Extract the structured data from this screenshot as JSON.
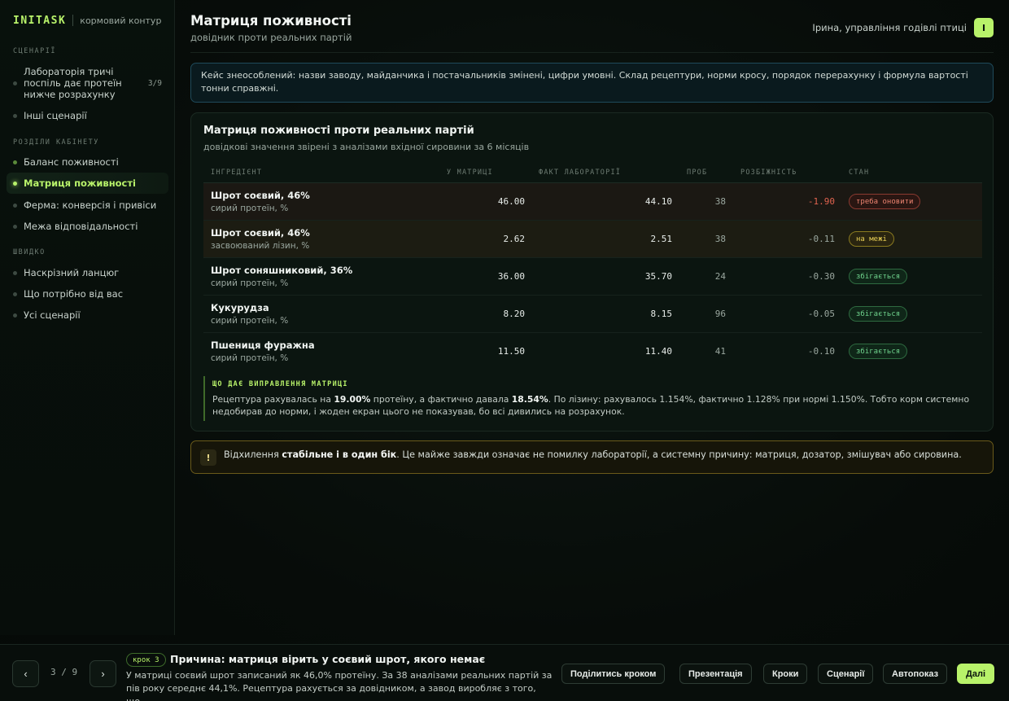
{
  "sidebar": {
    "brand": "INITASK",
    "brand_sub": "кормовий контур",
    "sections": {
      "scenarios": "СЦЕНАРІЇ",
      "cabinet": "РОЗДІЛИ КАБІНЕТУ",
      "quick": "ШВИДКО"
    },
    "scenario_items": [
      {
        "label": "Лабораторія тричі поспіль дає протеїн нижче розрахунку",
        "badge": "3/9"
      },
      {
        "label": "Інші сценарії"
      }
    ],
    "cabinet_items": [
      {
        "label": "Баланс поживності"
      },
      {
        "label": "Матриця поживності"
      },
      {
        "label": "Ферма: конверсія і привіси"
      },
      {
        "label": "Межа відповідальності"
      }
    ],
    "quick_items": [
      {
        "label": "Наскрізний ланцюг"
      },
      {
        "label": "Що потрібно від вас"
      },
      {
        "label": "Усі сценарії"
      }
    ]
  },
  "header": {
    "title": "Матриця поживності",
    "subtitle": "довідник проти реальних партій",
    "user": "Ірина, управління годівлі птиці",
    "avatar": "І"
  },
  "notice": "Кейс знеособлений: назви заводу, майданчика і постачальників змінені, цифри умовні. Склад рецептури, норми кросу, порядок перерахунку і формула вартості тонни справжні.",
  "card": {
    "title": "Матриця поживності проти реальних партій",
    "subtitle": "довідкові значення звірені з аналізами вхідної сировини за 6 місяців",
    "columns": [
      "ІНГРЕДІЄНТ",
      "У МАТРИЦІ",
      "ФАКТ ЛАБОРАТОРІЇ",
      "ПРОБ",
      "РОЗБІЖНІСТЬ",
      "СТАН"
    ],
    "rows": [
      {
        "name": "Шрот соєвий, 46%",
        "unit": "сирий протеїн, %",
        "matrix": "46.00",
        "fact": "44.10",
        "probes": "38",
        "diff": "-1.90",
        "status": "треба оновити"
      },
      {
        "name": "Шрот соєвий, 46%",
        "unit": "засвоюваний лізин, %",
        "matrix": "2.62",
        "fact": "2.51",
        "probes": "38",
        "diff": "-0.11",
        "status": "на межі"
      },
      {
        "name": "Шрот соняшниковий, 36%",
        "unit": "сирий протеїн, %",
        "matrix": "36.00",
        "fact": "35.70",
        "probes": "24",
        "diff": "-0.30",
        "status": "збігається"
      },
      {
        "name": "Кукурудза",
        "unit": "сирий протеїн, %",
        "matrix": "8.20",
        "fact": "8.15",
        "probes": "96",
        "diff": "-0.05",
        "status": "збігається"
      },
      {
        "name": "Пшениця фуражна",
        "unit": "сирий протеїн, %",
        "matrix": "11.50",
        "fact": "11.40",
        "probes": "41",
        "diff": "-0.10",
        "status": "збігається"
      }
    ],
    "fix": {
      "label": "ЩО ДАЄ ВИПРАВЛЕННЯ МАТРИЦІ",
      "t1": "Рецептура рахувалась на ",
      "b1": "19.00%",
      "t2": " протеїну, а фактично давала ",
      "b2": "18.54%",
      "t3": ". По лізину: рахувалось 1.154%, фактично 1.128% при нормі 1.150%. Тобто корм системно недобирав до норми, і жоден екран цього не показував, бо всі дивились на розрахунок."
    }
  },
  "alert": {
    "icon": "!",
    "t1": "Відхилення ",
    "b1": "стабільне і в один бік",
    "t2": ". Це майже завжди означає не помилку лабораторії, а системну причину: матриця, дозатор, змішувач або сировина."
  },
  "bottom": {
    "prev": "‹",
    "next": "›",
    "count": "3 / 9",
    "step_tag": "крок 3",
    "step_title": "Причина: матриця вірить у соєвий шрот, якого немає",
    "step_desc": "У матриці соєвий шрот записаний як 46,0% протеїну. За 38 аналізами реальних партій за пів року середнє 44,1%. Рецептура рахується за довідником, а завод виробляє з того, що...",
    "actions": [
      "Поділитись кроком",
      "Презентація",
      "Кроки",
      "Сценарії",
      "Автопоказ",
      "Далі"
    ]
  },
  "colors": {
    "accent": "#b8f26a",
    "bad": "#e0634f",
    "warn": "#e8cf55",
    "ok": "#6fd38d"
  }
}
